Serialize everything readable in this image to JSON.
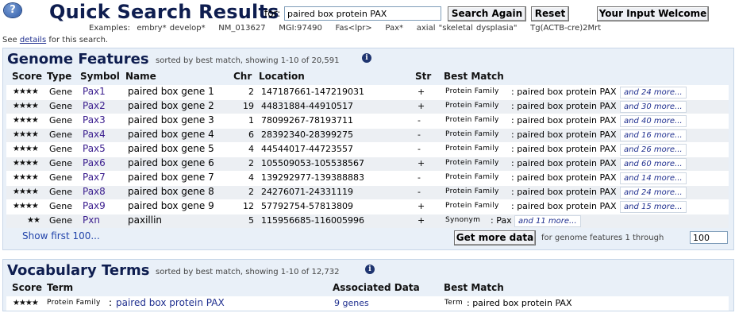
{
  "header": {
    "help_icon_glyph": "?",
    "title": "Quick Search Results",
    "for_label": "for:",
    "query_value": "paired box protein PAX",
    "search_again": "Search Again",
    "reset": "Reset",
    "input_welcome": "Your Input Welcome",
    "examples": "Examples:  embry* develop*    NM_013627    MGI:97490    Fas<lpr>    Pax*    axial \"skeletal dysplasia\"    Tg(ACTB-cre)2Mrt",
    "see_prefix": "See ",
    "details_link": "details",
    "see_suffix": " for this search."
  },
  "genome": {
    "title": "Genome Features",
    "subtitle": "sorted by best match, showing 1-10 of 20,591",
    "info_glyph": "i",
    "columns": [
      "Score",
      "Type",
      "Symbol",
      "Name",
      "Chr",
      "Location",
      "Str",
      "Best Match"
    ],
    "rows": [
      {
        "stars": "★★★★",
        "type": "Gene",
        "symbol": "Pax1",
        "name": "paired box gene 1",
        "chr": "2",
        "location": "147187661-147219031",
        "str": "+",
        "match_type": "Protein Family",
        "match_text": "paired box protein PAX",
        "more": "and 24 more..."
      },
      {
        "stars": "★★★★",
        "type": "Gene",
        "symbol": "Pax2",
        "name": "paired box gene 2",
        "chr": "19",
        "location": "44831884-44910517",
        "str": "+",
        "match_type": "Protein Family",
        "match_text": "paired box protein PAX",
        "more": "and 30 more..."
      },
      {
        "stars": "★★★★",
        "type": "Gene",
        "symbol": "Pax3",
        "name": "paired box gene 3",
        "chr": "1",
        "location": "78099267-78193711",
        "str": "-",
        "match_type": "Protein Family",
        "match_text": "paired box protein PAX",
        "more": "and 40 more..."
      },
      {
        "stars": "★★★★",
        "type": "Gene",
        "symbol": "Pax4",
        "name": "paired box gene 4",
        "chr": "6",
        "location": "28392340-28399275",
        "str": "-",
        "match_type": "Protein Family",
        "match_text": "paired box protein PAX",
        "more": "and 16 more..."
      },
      {
        "stars": "★★★★",
        "type": "Gene",
        "symbol": "Pax5",
        "name": "paired box gene 5",
        "chr": "4",
        "location": "44544017-44723557",
        "str": "-",
        "match_type": "Protein Family",
        "match_text": "paired box protein PAX",
        "more": "and 26 more..."
      },
      {
        "stars": "★★★★",
        "type": "Gene",
        "symbol": "Pax6",
        "name": "paired box gene 6",
        "chr": "2",
        "location": "105509053-105538567",
        "str": "+",
        "match_type": "Protein Family",
        "match_text": "paired box protein PAX",
        "more": "and 60 more..."
      },
      {
        "stars": "★★★★",
        "type": "Gene",
        "symbol": "Pax7",
        "name": "paired box gene 7",
        "chr": "4",
        "location": "139292977-139388883",
        "str": "-",
        "match_type": "Protein Family",
        "match_text": "paired box protein PAX",
        "more": "and 14 more..."
      },
      {
        "stars": "★★★★",
        "type": "Gene",
        "symbol": "Pax8",
        "name": "paired box gene 8",
        "chr": "2",
        "location": "24276071-24331119",
        "str": "-",
        "match_type": "Protein Family",
        "match_text": "paired box protein PAX",
        "more": "and 24 more..."
      },
      {
        "stars": "★★★★",
        "type": "Gene",
        "symbol": "Pax9",
        "name": "paired box gene 9",
        "chr": "12",
        "location": "57792754-57813809",
        "str": "+",
        "match_type": "Protein Family",
        "match_text": "paired box protein PAX",
        "more": "and 15 more..."
      },
      {
        "stars": "★★",
        "type": "Gene",
        "symbol": "Pxn",
        "name": "paxillin",
        "chr": "5",
        "location": "115956685-116005996",
        "str": "+",
        "match_type": "Synonym",
        "match_text": "Pax",
        "more": "and 11 more..."
      }
    ],
    "show_first": "Show first 100...",
    "get_more": "Get more data",
    "range_label": "for genome features 1 through",
    "range_value": "100"
  },
  "vocab": {
    "title": "Vocabulary Terms",
    "subtitle": "sorted by best match, showing 1-10 of 12,732",
    "info_glyph": "i",
    "columns": [
      "Score",
      "Term",
      "Associated Data",
      "Best Match"
    ],
    "rows": [
      {
        "stars": "★★★★",
        "term_type": "Protein Family",
        "term": "paired box protein PAX",
        "assoc": "9 genes",
        "match_type": "Term",
        "match_text": "paired box protein PAX"
      }
    ]
  }
}
